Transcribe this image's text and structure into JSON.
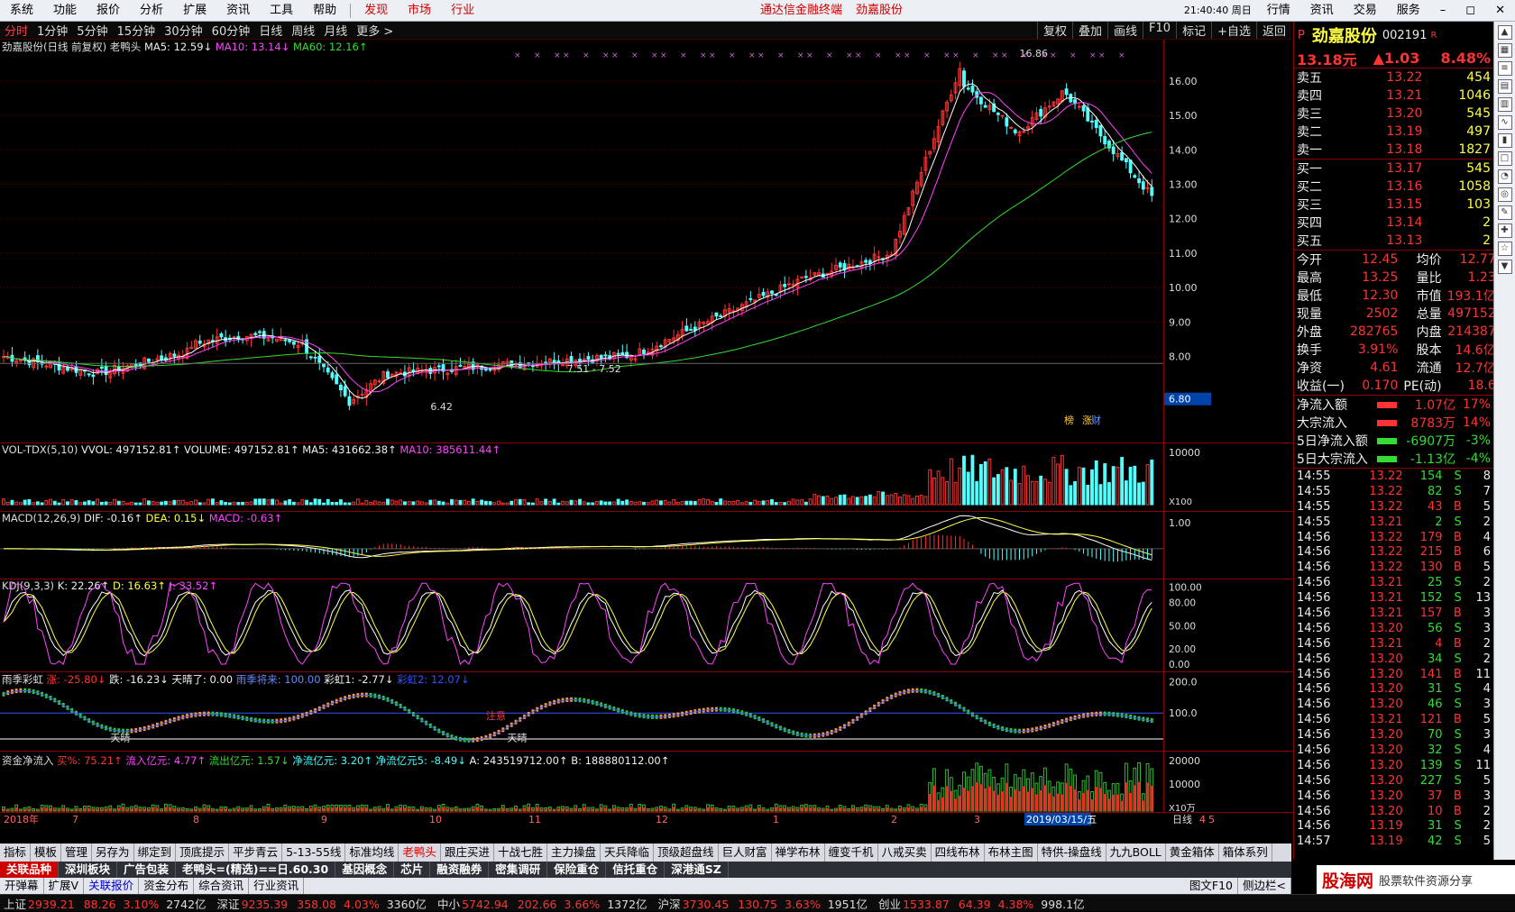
{
  "menu": {
    "items": [
      "系统",
      "功能",
      "报价",
      "分析",
      "扩展",
      "资讯",
      "工具",
      "帮助"
    ],
    "red_items": [
      "发现",
      "市场",
      "行业"
    ],
    "center_title": "通达信金融终端",
    "center_stock": "劲嘉股份",
    "clock": "21:40:40 周日",
    "right_btns": [
      "行情",
      "资讯",
      "交易",
      "服务"
    ]
  },
  "periods": {
    "items": [
      "分时",
      "1分钟",
      "5分钟",
      "15分钟",
      "30分钟",
      "60分钟",
      "日线",
      "周线",
      "月线",
      "更多 >"
    ],
    "active": "分时",
    "right": [
      "复权",
      "叠加",
      "画线",
      "F10",
      "标记",
      "+自选",
      "返回"
    ]
  },
  "main": {
    "title": "劲嘉股份(日线 前复权) 老鸭头",
    "ma5": "MA5: 12.59↓",
    "ma10": "MA10: 13.14↓",
    "ma60": "MA60: 12.16↑",
    "high_label": "16.86",
    "low_label": "6.42",
    "mid_label": "7.51 - 7.52",
    "cur_price_box": "6.80",
    "marks": [
      "榜",
      "涨",
      "财"
    ],
    "yticks": [
      "16.00",
      "15.00",
      "14.00",
      "13.00",
      "12.00",
      "11.00",
      "10.00",
      "9.00",
      "8.00"
    ]
  },
  "vol": {
    "title": "VOL-TDX(5,10)",
    "vvol": "VVOL: 497152.81↑",
    "volume": "VOLUME: 497152.81↑",
    "ma5": "MA5: 431662.38↑",
    "ma10": "MA10: 385611.44↑",
    "ytick": "10000",
    "unit": "X100"
  },
  "macd": {
    "title": "MACD(12,26,9)",
    "dif": "DIF: -0.16↑",
    "dea": "DEA: 0.15↓",
    "macd": "MACD: -0.63↑",
    "ytick": "1.00"
  },
  "kdj": {
    "title": "KDJ(9,3,3)",
    "k": "K: 22.26↑",
    "d": "D: 16.63↑",
    "j": "J: 33.52↑",
    "yticks": [
      "100.00",
      "80.00",
      "50.00",
      "20.00",
      "0.00"
    ]
  },
  "rain": {
    "title": "雨季彩虹",
    "zhang": "涨: -25.80↓",
    "die": "跌: -16.23↓",
    "tianqing": "天晴了: 0.00",
    "yuji": "雨季将来: 100.00",
    "caihong1": "彩虹1: -2.77↓",
    "caihong2": "彩虹2: 12.07↓",
    "yticks": [
      "200.0",
      "100.0"
    ],
    "label1": "天晴",
    "label2": "注意",
    "label3": "天晴"
  },
  "fund": {
    "title": "资金净流入",
    "buy": "买%: 75.21↑",
    "in": "流入亿元: 4.77↑",
    "out": "流出亿元: 1.57↓",
    "net": "净流亿元: 3.20↑",
    "net5": "净流亿元5: -8.49↓",
    "a": "A: 243519712.00↑",
    "b": "B: 188880112.00↑",
    "yticks": [
      "20000",
      "10000"
    ],
    "unit": "X10万"
  },
  "dates": {
    "items": [
      "2018年",
      "7",
      "8",
      "9",
      "10",
      "11",
      "12",
      "1",
      "2",
      "3",
      "2019/03/15/五",
      "4",
      "5"
    ],
    "period": "日线"
  },
  "quote": {
    "prefix": "P",
    "name": "劲嘉股份",
    "code": "002191",
    "suffix": "R",
    "price": "13.18元",
    "change": "▲1.03",
    "pct": "8.48%",
    "asks": [
      [
        "卖五",
        "13.22",
        "454"
      ],
      [
        "卖四",
        "13.21",
        "1046"
      ],
      [
        "卖三",
        "13.20",
        "545"
      ],
      [
        "卖二",
        "13.19",
        "497"
      ],
      [
        "卖一",
        "13.18",
        "1827"
      ]
    ],
    "bids": [
      [
        "买一",
        "13.17",
        "545"
      ],
      [
        "买二",
        "13.16",
        "1058"
      ],
      [
        "买三",
        "13.15",
        "103"
      ],
      [
        "买四",
        "13.14",
        "2"
      ],
      [
        "买五",
        "13.13",
        "2"
      ]
    ],
    "stats": [
      [
        "今开",
        "12.45",
        "均价",
        "12.77"
      ],
      [
        "最高",
        "13.25",
        "量比",
        "1.23"
      ],
      [
        "最低",
        "12.30",
        "市值",
        "193.1亿"
      ],
      [
        "现量",
        "2502",
        "总量",
        "497152"
      ],
      [
        "外盘",
        "282765",
        "内盘",
        "214387"
      ],
      [
        "换手",
        "3.91%",
        "股本",
        "14.6亿"
      ],
      [
        "净资",
        "4.61",
        "流通",
        "12.7亿"
      ],
      [
        "收益(一)",
        "0.170",
        "PE(动)",
        "18.6"
      ]
    ],
    "flows": [
      [
        "净流入额",
        "1.07亿",
        "17%"
      ],
      [
        "大宗流入",
        "8783万",
        "14%"
      ],
      [
        "5日净流入额",
        "-6907万",
        "-3%"
      ],
      [
        "5日大宗流入",
        "-1.13亿",
        "-4%"
      ]
    ],
    "ticks": [
      [
        "14:55",
        "13.22",
        "154",
        "S",
        "8"
      ],
      [
        "14:55",
        "13.22",
        "82",
        "S",
        "7"
      ],
      [
        "14:55",
        "13.22",
        "43",
        "B",
        "5"
      ],
      [
        "14:55",
        "13.21",
        "2",
        "S",
        "2"
      ],
      [
        "14:56",
        "13.22",
        "179",
        "B",
        "4"
      ],
      [
        "14:56",
        "13.22",
        "215",
        "B",
        "6"
      ],
      [
        "14:56",
        "13.22",
        "130",
        "B",
        "5"
      ],
      [
        "14:56",
        "13.21",
        "25",
        "S",
        "2"
      ],
      [
        "14:56",
        "13.21",
        "152",
        "S",
        "13"
      ],
      [
        "14:56",
        "13.21",
        "157",
        "B",
        "3"
      ],
      [
        "14:56",
        "13.20",
        "56",
        "S",
        "3"
      ],
      [
        "14:56",
        "13.21",
        "4",
        "B",
        "2"
      ],
      [
        "14:56",
        "13.20",
        "34",
        "S",
        "2"
      ],
      [
        "14:56",
        "13.20",
        "141",
        "B",
        "11"
      ],
      [
        "14:56",
        "13.20",
        "31",
        "S",
        "4"
      ],
      [
        "14:56",
        "13.20",
        "46",
        "S",
        "3"
      ],
      [
        "14:56",
        "13.21",
        "121",
        "B",
        "5"
      ],
      [
        "14:56",
        "13.20",
        "70",
        "S",
        "3"
      ],
      [
        "14:56",
        "13.20",
        "32",
        "S",
        "4"
      ],
      [
        "14:56",
        "13.20",
        "139",
        "S",
        "11"
      ],
      [
        "14:56",
        "13.20",
        "227",
        "S",
        "5"
      ],
      [
        "14:56",
        "13.20",
        "37",
        "B",
        "3"
      ],
      [
        "14:56",
        "13.20",
        "10",
        "B",
        "2"
      ],
      [
        "14:56",
        "13.19",
        "31",
        "S",
        "2"
      ],
      [
        "14:57",
        "13.19",
        "42",
        "S",
        "5"
      ]
    ]
  },
  "tabs1": [
    "指标",
    "模板",
    "管理",
    "另存为",
    "绑定到",
    "顶底提示",
    "平步青云",
    "5-13-55线",
    "标准均线",
    "老鸭头",
    "跟庄买进",
    "十战七胜",
    "主力操盘",
    "天兵降临",
    "顶级超盘线",
    "巨人财富",
    "禅学布林",
    "缠变千机",
    "八戒买卖",
    "四线布林",
    "布林主图",
    "特供-操盘线",
    "九九BOLL",
    "黄金箱体",
    "箱体系列"
  ],
  "tabs2": [
    "关联品种",
    "深圳板块",
    "广告包装",
    "老鸭头=(精选)==日.60.30",
    "基因概念",
    "芯片",
    "融资融券",
    "密集调研",
    "保险重仓",
    "信托重仓",
    "深港通SZ"
  ],
  "tabs3": [
    "开弹幕",
    "扩展V",
    "关联报价",
    "资金分布",
    "综合资讯",
    "行业资讯"
  ],
  "tabs3_right": [
    "图文F10",
    "侧边栏<"
  ],
  "status": [
    [
      "上证",
      "2939.21",
      "88.26",
      "3.10%",
      "2742亿"
    ],
    [
      "深证",
      "9235.39",
      "358.08",
      "4.03%",
      "3360亿"
    ],
    [
      "中小",
      "5742.94",
      "202.66",
      "3.66%",
      "1372亿"
    ],
    [
      "沪深",
      "3730.45",
      "130.75",
      "3.63%",
      "1951亿"
    ],
    [
      "创业",
      "1533.87",
      "64.39",
      "4.38%",
      "998.1亿"
    ]
  ],
  "logo": {
    "text": "股海网",
    "sub": "股票软件资源分享",
    "url": "www.Guhai.com.cn"
  },
  "colors": {
    "up": "#ff3333",
    "down": "#54ffff",
    "ma5": "#ffffff",
    "ma10": "#ff44ff",
    "ma60": "#33dd33"
  }
}
